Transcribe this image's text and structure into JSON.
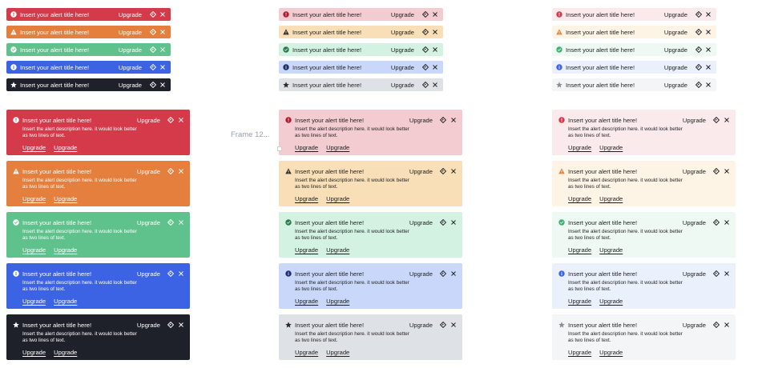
{
  "frame_label": "Frame 12...",
  "alert_title": "Insert your alert title here!",
  "alert_description": "Insert the alert description here. it would look better as two lines of text.",
  "upgrade_label": "Upgrade",
  "link_primary": "Upgrade",
  "link_secondary": "Upgrade",
  "variants": [
    {
      "name": "error",
      "icon": "error-icon",
      "solid": {
        "bg": "#d43a4a",
        "fg": "#ffffff",
        "icon_color": "#ffffff"
      },
      "subtle": {
        "bg": "#f3ccd2",
        "fg": "#1f1f1f",
        "icon_color": "#b01c2e"
      },
      "light": {
        "bg": "#faeaec",
        "fg": "#1f1f1f",
        "icon_color": "#d43a4a"
      }
    },
    {
      "name": "warning",
      "icon": "warning-icon",
      "solid": {
        "bg": "#e57f3e",
        "fg": "#ffffff",
        "icon_color": "#ffffff"
      },
      "subtle": {
        "bg": "#f8dfb7",
        "fg": "#1f1f1f",
        "icon_color": "#2b2b2b"
      },
      "light": {
        "bg": "#fdf4e6",
        "fg": "#1f1f1f",
        "icon_color": "#e57f3e"
      }
    },
    {
      "name": "success",
      "icon": "check-circle-icon",
      "solid": {
        "bg": "#5fc18b",
        "fg": "#ffffff",
        "icon_color": "#ffffff"
      },
      "subtle": {
        "bg": "#d3f2e2",
        "fg": "#1f1f1f",
        "icon_color": "#2c7a4f"
      },
      "light": {
        "bg": "#edf9f2",
        "fg": "#1f1f1f",
        "icon_color": "#41b06f"
      }
    },
    {
      "name": "info",
      "icon": "info-icon",
      "solid": {
        "bg": "#3d63e5",
        "fg": "#ffffff",
        "icon_color": "#ffffff"
      },
      "subtle": {
        "bg": "#c9d8fa",
        "fg": "#1f1f1f",
        "icon_color": "#1f2f6b"
      },
      "light": {
        "bg": "#ebf0fd",
        "fg": "#1f1f1f",
        "icon_color": "#3d63e5"
      }
    },
    {
      "name": "neutral",
      "icon": "star-icon",
      "solid": {
        "bg": "#1e2129",
        "fg": "#ffffff",
        "icon_color": "#ffffff"
      },
      "subtle": {
        "bg": "#dee1e5",
        "fg": "#1f1f1f",
        "icon_color": "#2b2b2b"
      },
      "light": {
        "bg": "#f4f5f7",
        "fg": "#1f1f1f",
        "icon_color": "#8b8f95"
      }
    }
  ]
}
